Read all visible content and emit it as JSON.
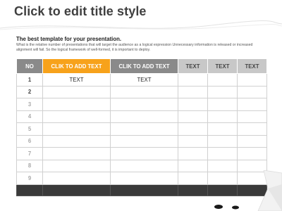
{
  "slide": {
    "title": "Click to edit title style",
    "subtitle": "The best template for your presentation.",
    "description": "What is the relative number of presentations that will target the audience as a logical expression Unnecessary information is released or increased alignment will fail. So the logical framework of well-formed, it is important to deploy."
  },
  "table": {
    "headers": [
      "NO",
      "CLIK TO ADD TEXT",
      "CLIK TO ADD TEXT",
      "TEXT",
      "TEXT",
      "TEXT"
    ],
    "rows": [
      [
        "1",
        "TEXT",
        "TEXT",
        "",
        "",
        ""
      ],
      [
        "2",
        "",
        "",
        "",
        "",
        ""
      ],
      [
        "3",
        "",
        "",
        "",
        "",
        ""
      ],
      [
        "4",
        "",
        "",
        "",
        "",
        ""
      ],
      [
        "5",
        "",
        "",
        "",
        "",
        ""
      ],
      [
        "6",
        "",
        "",
        "",
        "",
        ""
      ],
      [
        "7",
        "",
        "",
        "",
        "",
        ""
      ],
      [
        "8",
        "",
        "",
        "",
        "",
        ""
      ],
      [
        "9",
        "",
        "",
        "",
        "",
        ""
      ]
    ]
  },
  "colors": {
    "header_orange": "#f7a21b",
    "header_gray": "#8a8a8a",
    "header_light": "#c8c8c8",
    "footer_dark": "#3a3a3a"
  }
}
